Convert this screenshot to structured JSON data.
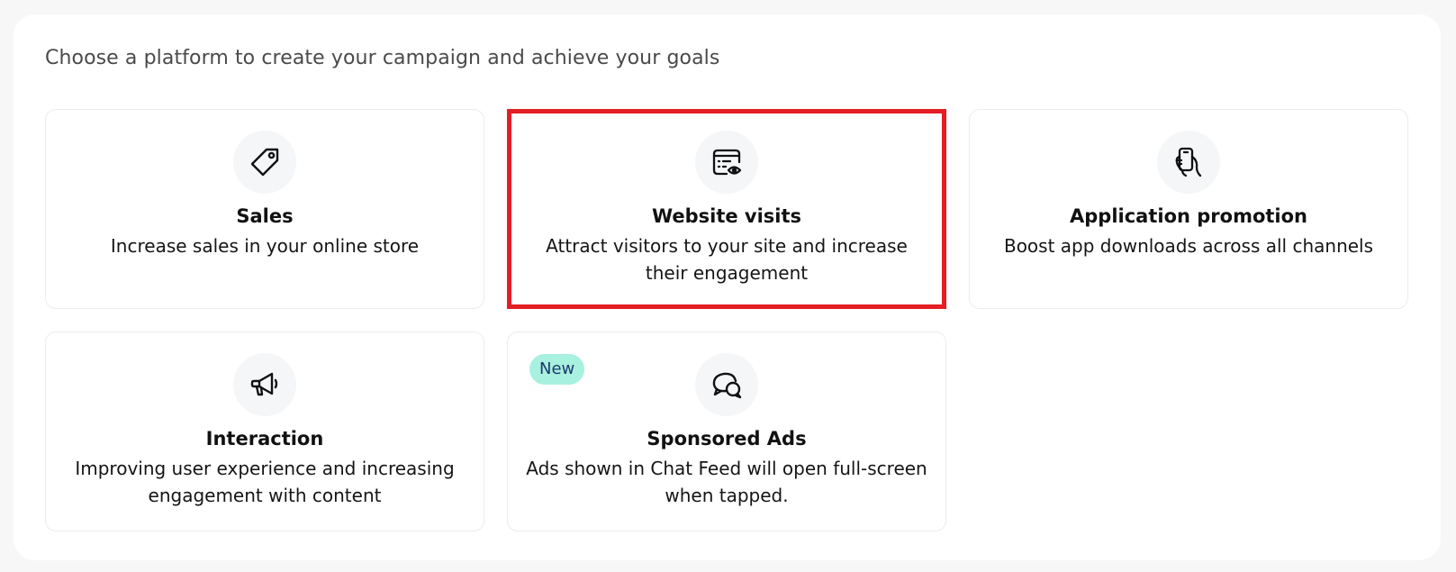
{
  "heading": "Choose a platform to create your campaign and achieve your goals",
  "cards": [
    {
      "icon": "price-tag-icon",
      "title": "Sales",
      "description": "Increase sales in your online store",
      "selected": false
    },
    {
      "icon": "browser-eye-icon",
      "title": "Website visits",
      "description": "Attract visitors to your site and increase their engagement",
      "selected": true
    },
    {
      "icon": "hand-phone-icon",
      "title": "Application promotion",
      "description": "Boost app downloads across all channels",
      "selected": false
    },
    {
      "icon": "megaphone-icon",
      "title": "Interaction",
      "description": "Improving user experience and increasing engagement with content",
      "selected": false
    },
    {
      "icon": "chat-bubbles-icon",
      "title": "Sponsored Ads",
      "description": "Ads shown in Chat Feed will open full-screen when tapped.",
      "badge": "New",
      "selected": false
    }
  ],
  "colors": {
    "selected_border": "#e31e24",
    "badge_background": "#a8f0df",
    "badge_text": "#1c3a6b"
  }
}
